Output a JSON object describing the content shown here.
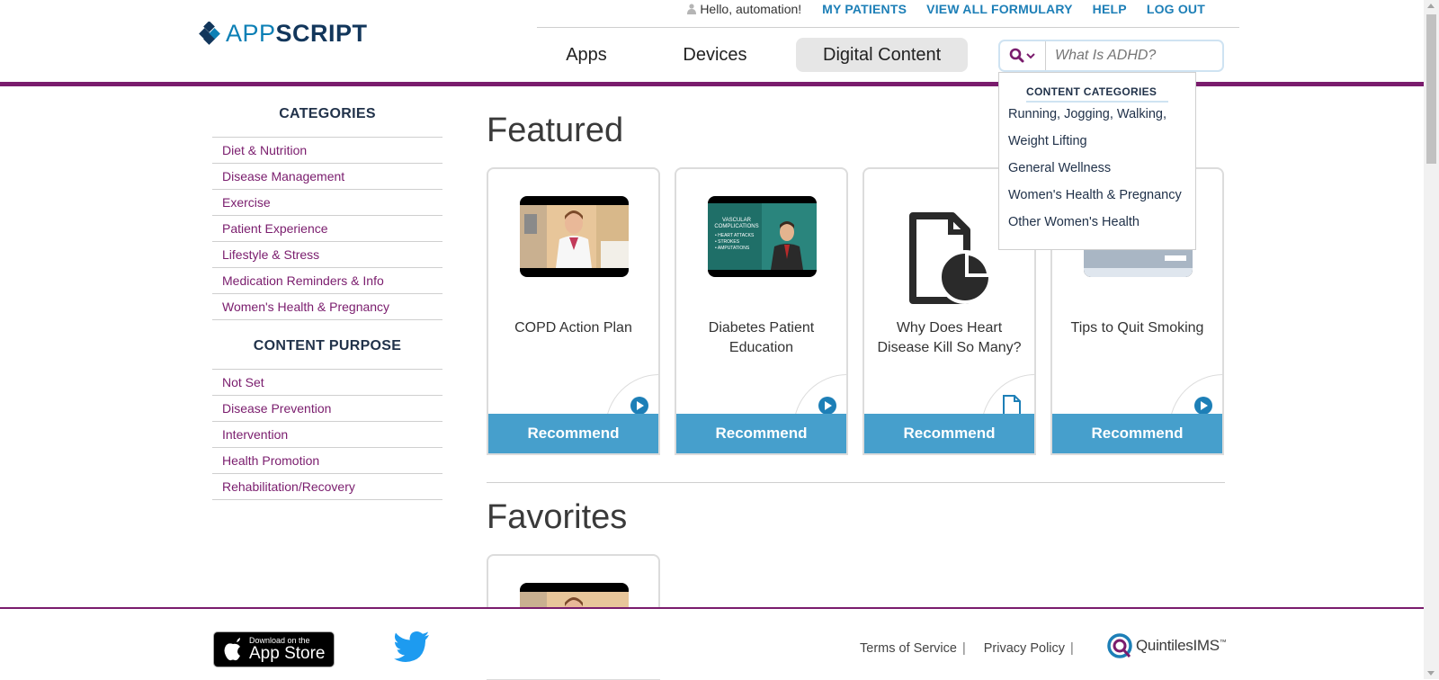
{
  "brand": {
    "logo_light": "APP",
    "logo_bold": "SCRIPT"
  },
  "userbar": {
    "greeting": "Hello, automation!",
    "links": [
      "MY PATIENTS",
      "VIEW ALL FORMULARY",
      "HELP",
      "LOG OUT"
    ]
  },
  "nav": {
    "tabs": [
      "Apps",
      "Devices",
      "Digital Content"
    ],
    "active": "Digital Content"
  },
  "search": {
    "placeholder": "What Is ADHD?"
  },
  "dropdown": {
    "title": "CONTENT CATEGORIES",
    "items": [
      "Running, Jogging, Walking,",
      "Weight Lifting",
      "General Wellness",
      "Women's Health & Pregnancy",
      "Other Women's Health"
    ]
  },
  "sidebar": {
    "categories_title": "CATEGORIES",
    "categories": [
      "Diet & Nutrition",
      "Disease Management",
      "Exercise",
      "Patient Experience",
      "Lifestyle & Stress",
      "Medication Reminders & Info",
      "Women's Health & Pregnancy"
    ],
    "purpose_title": "CONTENT PURPOSE",
    "purposes": [
      "Not Set",
      "Disease Prevention",
      "Intervention",
      "Health Promotion",
      "Rehabilitation/Recovery"
    ]
  },
  "featured": {
    "title": "Featured",
    "cards": [
      {
        "title": "COPD Action Plan",
        "button": "Recommend",
        "media": "video"
      },
      {
        "title": "Diabetes Patient Education",
        "button": "Recommend",
        "media": "video",
        "thumb_lines": [
          "VASCULAR",
          "COMPLICATIONS",
          "• HEART ATTACKS",
          "• STROKES",
          "• AMPUTATIONS"
        ]
      },
      {
        "title": "Why Does Heart Disease Kill So Many?",
        "button": "Recommend",
        "media": "document"
      },
      {
        "title": "Tips to Quit Smoking",
        "button": "Recommend",
        "media": "video"
      }
    ]
  },
  "favorites": {
    "title": "Favorites"
  },
  "footer": {
    "appstore_small": "Download on the",
    "appstore_big": "App Store",
    "terms": "Terms of Service",
    "privacy": "Privacy Policy",
    "separator": "|",
    "partner": "QuintilesIMS",
    "partner_tm": "™"
  },
  "colors": {
    "accent_purple": "#7a1c6d",
    "button_blue": "#469fcc",
    "link_blue": "#1d7fb7",
    "navy": "#12365b"
  }
}
